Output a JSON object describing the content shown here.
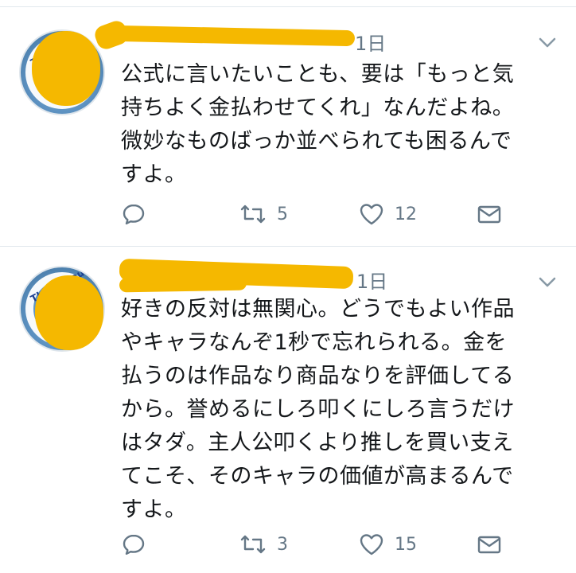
{
  "tweets": [
    {
      "time": "1日",
      "text": "公式に言いたいことも、要は「もっと気\n持ちよく金払わせてくれ」なんだよね。\n微妙なものばっか並べられても困るんで\nすよ。",
      "retweets": "5",
      "likes": "12",
      "avatar_text": "Thank you M"
    },
    {
      "time": "1日",
      "text": "好きの反対は無関心。どうでもよい作品\nやキャラなんぞ1秒で忘れられる。金を\n払うのは作品なり商品なりを評価してる\nから。誉めるにしろ叩くにしろ言うだけ\nはタダ。主人公叩くより推しを買い支え\nてこそ、そのキャラの価値が高まるんで\nすよ。",
      "retweets": "3",
      "likes": "15",
      "avatar_text": "Thank you M"
    }
  ],
  "icons": {
    "reply": "reply-icon",
    "retweet": "retweet-icon",
    "like": "heart-icon",
    "dm": "envelope-icon",
    "more": "chevron-down-icon"
  },
  "colors": {
    "text": "#14171a",
    "muted": "#657786",
    "redaction": "#f5b800",
    "divider": "#e1e8ed"
  }
}
